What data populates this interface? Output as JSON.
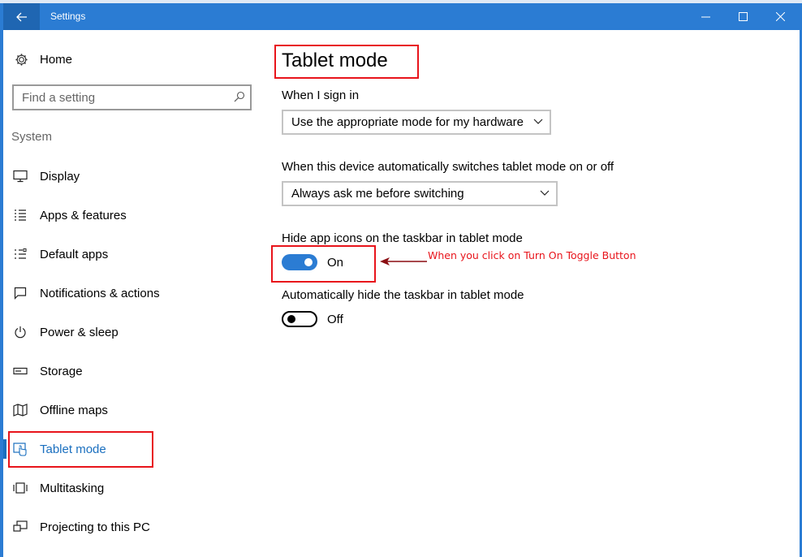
{
  "window": {
    "title": "Settings",
    "accent": "#2b7cd3"
  },
  "sidebar": {
    "home": "Home",
    "search_placeholder": "Find a setting",
    "section": "System",
    "items": [
      {
        "label": "Display",
        "icon": "monitor-icon"
      },
      {
        "label": "Apps & features",
        "icon": "list-icon"
      },
      {
        "label": "Default apps",
        "icon": "default-apps-icon"
      },
      {
        "label": "Notifications & actions",
        "icon": "notification-icon"
      },
      {
        "label": "Power & sleep",
        "icon": "power-icon"
      },
      {
        "label": "Storage",
        "icon": "storage-icon"
      },
      {
        "label": "Offline maps",
        "icon": "map-icon"
      },
      {
        "label": "Tablet mode",
        "icon": "tablet-mode-icon",
        "active": true
      },
      {
        "label": "Multitasking",
        "icon": "multitasking-icon"
      },
      {
        "label": "Projecting to this PC",
        "icon": "projecting-icon"
      }
    ]
  },
  "main": {
    "title": "Tablet mode",
    "signin_label": "When I sign in",
    "signin_value": "Use the appropriate mode for my hardware",
    "switch_label": "When this device automatically switches tablet mode on or off",
    "switch_value": "Always ask me before switching",
    "hide_icons_label": "Hide app icons on the taskbar in tablet mode",
    "hide_icons_state": "On",
    "hide_taskbar_label": "Automatically hide the taskbar in tablet mode",
    "hide_taskbar_state": "Off"
  },
  "annotation": {
    "text": "When you click on Turn On Toggle Button",
    "color": "#e8141b"
  }
}
